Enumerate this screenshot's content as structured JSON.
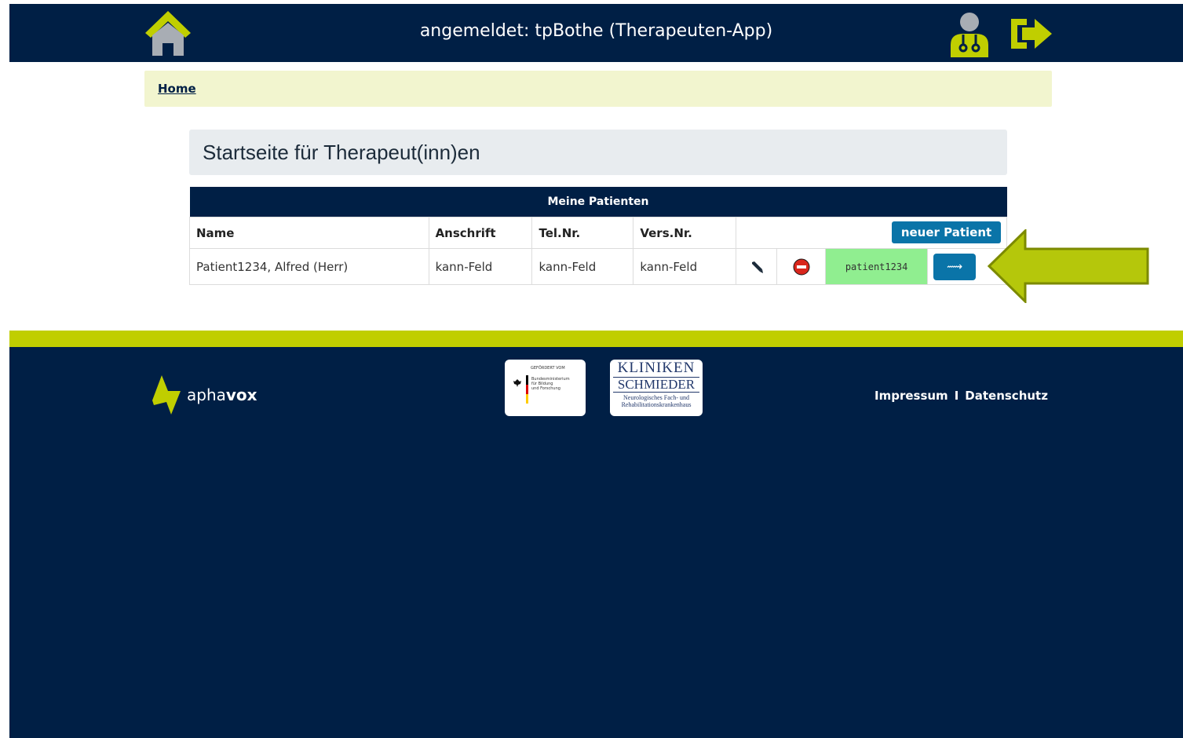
{
  "header": {
    "title": "angemeldet: tpBothe (Therapeuten-App)",
    "icons": {
      "home": "home-icon",
      "user": "doctor-user-icon",
      "logout": "logout-icon"
    }
  },
  "breadcrumb": {
    "home": "Home"
  },
  "page": {
    "title": "Startseite für Therapeut(inn)en"
  },
  "patients_table": {
    "caption": "Meine Patienten",
    "columns": [
      "Name",
      "Anschrift",
      "Tel.Nr.",
      "Vers.Nr."
    ],
    "new_button": "neuer Patient",
    "rows": [
      {
        "name": "Patient1234, Alfred (Herr)",
        "address": "kann-Feld",
        "phone": "kann-Feld",
        "insurance": "kann-Feld",
        "login": "patient1234",
        "go_label": "⟿"
      }
    ]
  },
  "footer": {
    "brand_light": "apha",
    "brand_bold": "vox",
    "bmbf_lines": [
      "GEFÖRDERT VOM",
      "Bundesministerium",
      "für Bildung",
      "und Forschung"
    ],
    "kliniken_lines": [
      "KLINIKEN",
      "SCHMIEDER",
      "Neurologisches Fach- und",
      "Rehabilitationskrankenhaus"
    ],
    "links": [
      "Impressum",
      "Datenschutz"
    ],
    "separator": "I"
  },
  "colors": {
    "navy": "#001f45",
    "accent_green": "#c0ce00",
    "button_blue": "#0a74a8",
    "breadcrumb_bg": "#f2f5cf",
    "login_bg": "#90ee90"
  }
}
